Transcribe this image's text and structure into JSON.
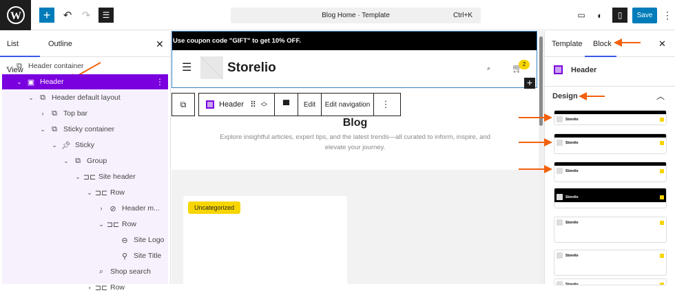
{
  "topbar": {
    "title": "Blog Home · Template",
    "shortcut": "Ctrl+K",
    "save": "Save"
  },
  "listview": {
    "tabs": [
      "List View",
      "Outline"
    ],
    "items": [
      {
        "label": "Header container",
        "level": 0,
        "chev": "down",
        "icon": "group"
      },
      {
        "label": "Header",
        "level": 1,
        "chev": "down",
        "icon": "template-part",
        "selected": true
      },
      {
        "label": "Header default layout",
        "level": 2,
        "chev": "down",
        "icon": "group"
      },
      {
        "label": "Top bar",
        "level": 3,
        "chev": "right",
        "icon": "group"
      },
      {
        "label": "Sticky container",
        "level": 3,
        "chev": "down",
        "icon": "group"
      },
      {
        "label": "Sticky",
        "level": 4,
        "chev": "down",
        "icon": "pin"
      },
      {
        "label": "Group",
        "level": 5,
        "chev": "down",
        "icon": "group"
      },
      {
        "label": "Site header",
        "level": 6,
        "chev": "down",
        "icon": "row"
      },
      {
        "label": "Row",
        "level": 7,
        "chev": "down",
        "icon": "row"
      },
      {
        "label": "Header m...",
        "level": 8,
        "chev": "right",
        "icon": "compass"
      },
      {
        "label": "Row",
        "level": 8,
        "chev": "down",
        "icon": "row"
      },
      {
        "label": "Site Logo",
        "level": 9,
        "chev": "",
        "icon": "logo"
      },
      {
        "label": "Site Title",
        "level": 9,
        "chev": "",
        "icon": "map-pin"
      },
      {
        "label": "Shop search",
        "level": 7,
        "chev": "",
        "icon": "search-box"
      },
      {
        "label": "Row",
        "level": 7,
        "chev": "right",
        "icon": "row"
      }
    ]
  },
  "canvas": {
    "coupon": "Use coupon code \"GIFT\" to get 10% OFF.",
    "site_title": "Storelio",
    "cart_count": "2",
    "toolbar": {
      "block": "Header",
      "edit": "Edit",
      "edit_nav": "Edit navigation"
    },
    "heading": "Blog",
    "description": "Explore insightful articles, expert tips, and the latest trends—all curated to inform, inspire, and elevate your journey.",
    "badge": "Uncategorized"
  },
  "sidebar": {
    "tabs": [
      "Template",
      "Block"
    ],
    "block_name": "Header",
    "section": "Design",
    "preview_title": "Storelio"
  },
  "colors": {
    "accent": "#3858e9",
    "save": "#007cba",
    "selected": "#7a00df",
    "arrow": "#f2600c",
    "badge": "#f7d501"
  }
}
